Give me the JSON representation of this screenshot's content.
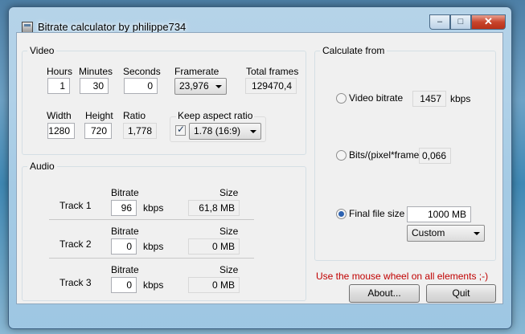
{
  "window": {
    "title": "Bitrate calculator by philippe734",
    "close_glyph": "✕",
    "minimize_glyph": "–",
    "maximize_glyph": "□"
  },
  "video": {
    "label": "Video",
    "hours_label": "Hours",
    "hours_value": "1",
    "minutes_label": "Minutes",
    "minutes_value": "30",
    "seconds_label": "Seconds",
    "seconds_value": "0",
    "framerate_label": "Framerate",
    "framerate_value": "23,976",
    "total_frames_label": "Total frames",
    "total_frames_value": "129470,4",
    "width_label": "Width",
    "width_value": "1280",
    "height_label": "Height",
    "height_value": "720",
    "ratio_label": "Ratio",
    "ratio_value": "1,778",
    "keep_aspect_label": "Keep aspect ratio",
    "keep_aspect_checked": true,
    "aspect_value": "1.78 (16:9)"
  },
  "audio": {
    "label": "Audio",
    "bitrate_label": "Bitrate",
    "size_label": "Size",
    "kbps": "kbps",
    "tracks": [
      {
        "name": "Track 1",
        "bitrate": "96",
        "size": "61,8 MB"
      },
      {
        "name": "Track 2",
        "bitrate": "0",
        "size": "0 MB"
      },
      {
        "name": "Track 3",
        "bitrate": "0",
        "size": "0 MB"
      }
    ]
  },
  "calculate": {
    "label": "Calculate from",
    "video_bitrate_label": "Video bitrate",
    "video_bitrate_value": "1457",
    "video_bitrate_unit": "kbps",
    "bits_label": "Bits/(pixel*frame)",
    "bits_value": "0,066",
    "final_size_label": "Final file size",
    "final_size_value": "1000 MB",
    "selected": "final_size",
    "preset_value": "Custom"
  },
  "hint": "Use the mouse wheel on all elements ;-)",
  "buttons": {
    "about": "About...",
    "quit": "Quit"
  }
}
